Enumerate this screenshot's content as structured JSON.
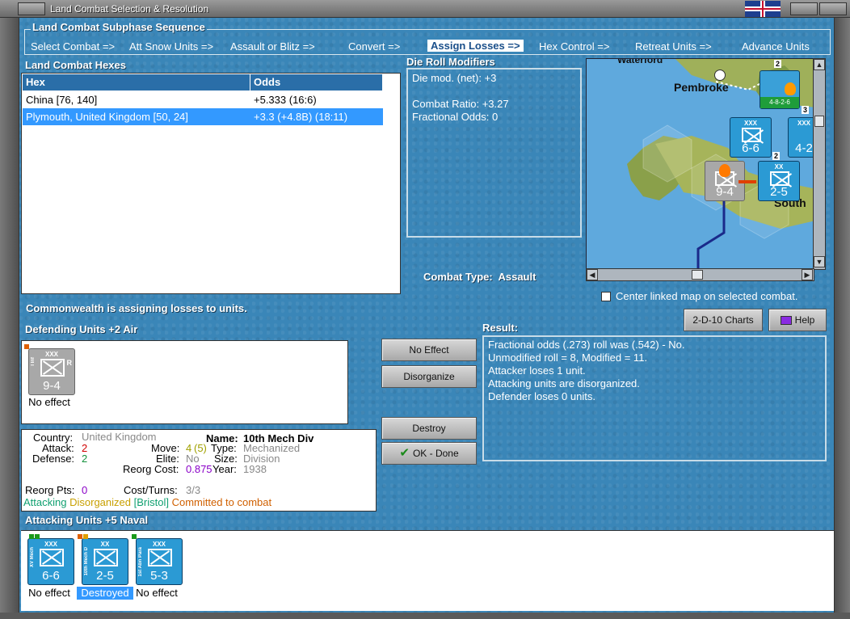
{
  "window": {
    "title": "Land Combat Selection & Resolution"
  },
  "subphase": {
    "title": "Land Combat Subphase Sequence",
    "steps": [
      "Select Combat =>",
      "Att Snow Units =>",
      "Assault or Blitz =>",
      "Convert =>",
      "Assign Losses =>",
      "Hex Control =>",
      "Retreat Units =>",
      "Advance Units"
    ],
    "active_index": 4
  },
  "hexes": {
    "title": "Land Combat Hexes",
    "columns": [
      "Hex",
      "Odds"
    ],
    "rows": [
      {
        "hex": "China [76, 140]",
        "odds": "+5.333 (16:6)",
        "selected": false
      },
      {
        "hex": "Plymouth, United Kingdom [50, 24]",
        "odds": "+3.3 (+4.8B) (18:11)",
        "selected": true
      }
    ]
  },
  "die_roll": {
    "title": "Die Roll Modifiers",
    "die_mod": "Die mod. (net): +3",
    "combat_ratio": "Combat Ratio: +3.27",
    "fractional_odds": "Fractional Odds: 0"
  },
  "combat_type": {
    "label": "Combat Type:",
    "value": "Assault"
  },
  "map": {
    "labels": {
      "pembroke": "Pembroke",
      "south": "South",
      "waterford": "Waterford",
      "th": "th"
    },
    "counters": [
      {
        "name": "XV Mech",
        "size": "XXX",
        "values": "6-6",
        "stack": ""
      },
      {
        "name": "I",
        "size": "XXX",
        "values": "4-2",
        "stack": "3"
      },
      {
        "name": "10th Mech D",
        "size": "XX",
        "values": "2-5",
        "stack": "2"
      },
      {
        "name": "I Inf",
        "size": "XXX",
        "values": "9-4",
        "stack": ""
      },
      {
        "name": "",
        "size": "",
        "values": "4-8-2-6",
        "stack": "2"
      }
    ]
  },
  "center_map": {
    "label": "Center linked map on selected combat.",
    "checked": false
  },
  "status": {
    "message": "Commonwealth is assigning losses to units."
  },
  "buttons": {
    "charts": "2-D-10 Charts",
    "help": "Help",
    "no_effect": "No Effect",
    "disorganize": "Disorganize",
    "destroy": "Destroy",
    "ok_done": "OK - Done"
  },
  "defending": {
    "title": "Defending Units +2 Air",
    "units": [
      {
        "name": "I Inf",
        "size": "XXX",
        "values": "9-4",
        "flag": "R",
        "status": "No effect"
      }
    ]
  },
  "unit_info": {
    "country_label": "Country:",
    "country": "United Kingdom",
    "name_label": "Name:",
    "name": "10th Mech Div",
    "attack_label": "Attack:",
    "attack": "2",
    "move_label": "Move:",
    "move": "4",
    "move_extra": "(5)",
    "type_label": "Type:",
    "type": "Mechanized",
    "defense_label": "Defense:",
    "defense": "2",
    "elite_label": "Elite:",
    "elite": "No",
    "size_label": "Size:",
    "size": "Division",
    "reorg_cost_label": "Reorg Cost:",
    "reorg_cost": "0.875",
    "year_label": "Year:",
    "year": "1938",
    "reorg_pts_label": "Reorg Pts:",
    "reorg_pts": "0",
    "cost_turns_label": "Cost/Turns:",
    "cost_turns": "3/3",
    "status_attacking": "Attacking",
    "status_disorganized": "Disorganized",
    "status_location": "[Bristol]",
    "status_committed": "Committed to combat"
  },
  "result": {
    "title": "Result:",
    "lines": [
      "Fractional odds (.273) roll was (.542)  - No.",
      "Unmodified roll = 8, Modified = 11.",
      "Attacker loses 1 unit.",
      "Attacking units are disorganized.",
      "Defender loses 0 units."
    ]
  },
  "attacking": {
    "title": "Attacking Units +5 Naval",
    "units": [
      {
        "name": "XV Mech",
        "size": "XXX",
        "values": "6-6",
        "status": "No effect",
        "destroyed": false
      },
      {
        "name": "10th Mech D",
        "size": "XX",
        "values": "2-5",
        "status": "Destroyed",
        "destroyed": true
      },
      {
        "name": "1st Abn Para",
        "size": "XXX",
        "values": "5-3",
        "status": "No effect",
        "destroyed": false
      }
    ]
  },
  "colors": {
    "ocean": "#3a86b8",
    "counter_blue": "#2b9ad4",
    "selection": "#3399ff"
  }
}
